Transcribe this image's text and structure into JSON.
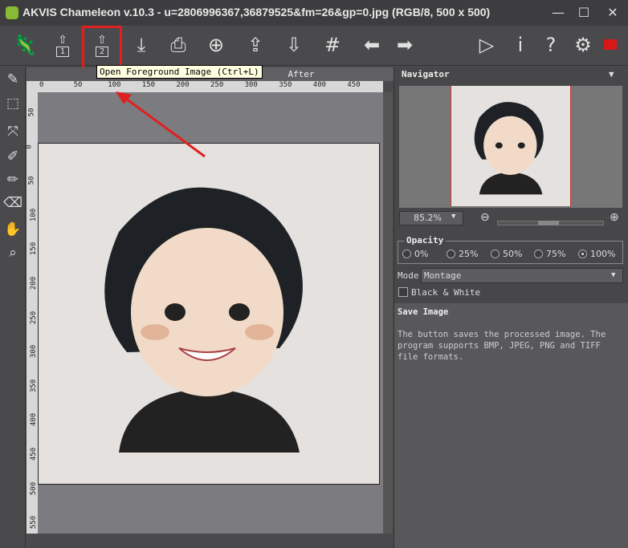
{
  "window": {
    "title": "AKVIS Chameleon v.10.3 - u=2806996367,36879525&fm=26&gp=0.jpg (RGB/8, 500 x 500)",
    "minimize": "—",
    "maximize": "☐",
    "close": "✕"
  },
  "toolbar": {
    "tooltip": "Open Foreground Image (Ctrl+L)",
    "open_bg_num": "1",
    "open_fg_num": "2"
  },
  "tabs": {
    "after": "After"
  },
  "ruler": {
    "h": [
      "0",
      "50",
      "100",
      "150",
      "200",
      "250",
      "300",
      "350",
      "400",
      "450"
    ],
    "v": [
      "50",
      "0",
      "50",
      "100",
      "150",
      "200",
      "250",
      "300",
      "350",
      "400",
      "450",
      "500",
      "550"
    ]
  },
  "navigator": {
    "title": "Navigator",
    "zoom": "85.2%"
  },
  "opacity": {
    "label": "Opacity",
    "options": [
      "0%",
      "25%",
      "50%",
      "75%",
      "100%"
    ],
    "selected": "100%"
  },
  "mode": {
    "label": "Mode",
    "value": "Montage"
  },
  "bw": {
    "label": "Black & White",
    "checked": false
  },
  "help": {
    "title": "Save Image",
    "text": "The button saves the processed image. The program supports BMP, JPEG, PNG and TIFF file formats."
  },
  "colors": {
    "highlight": "#e02020"
  }
}
